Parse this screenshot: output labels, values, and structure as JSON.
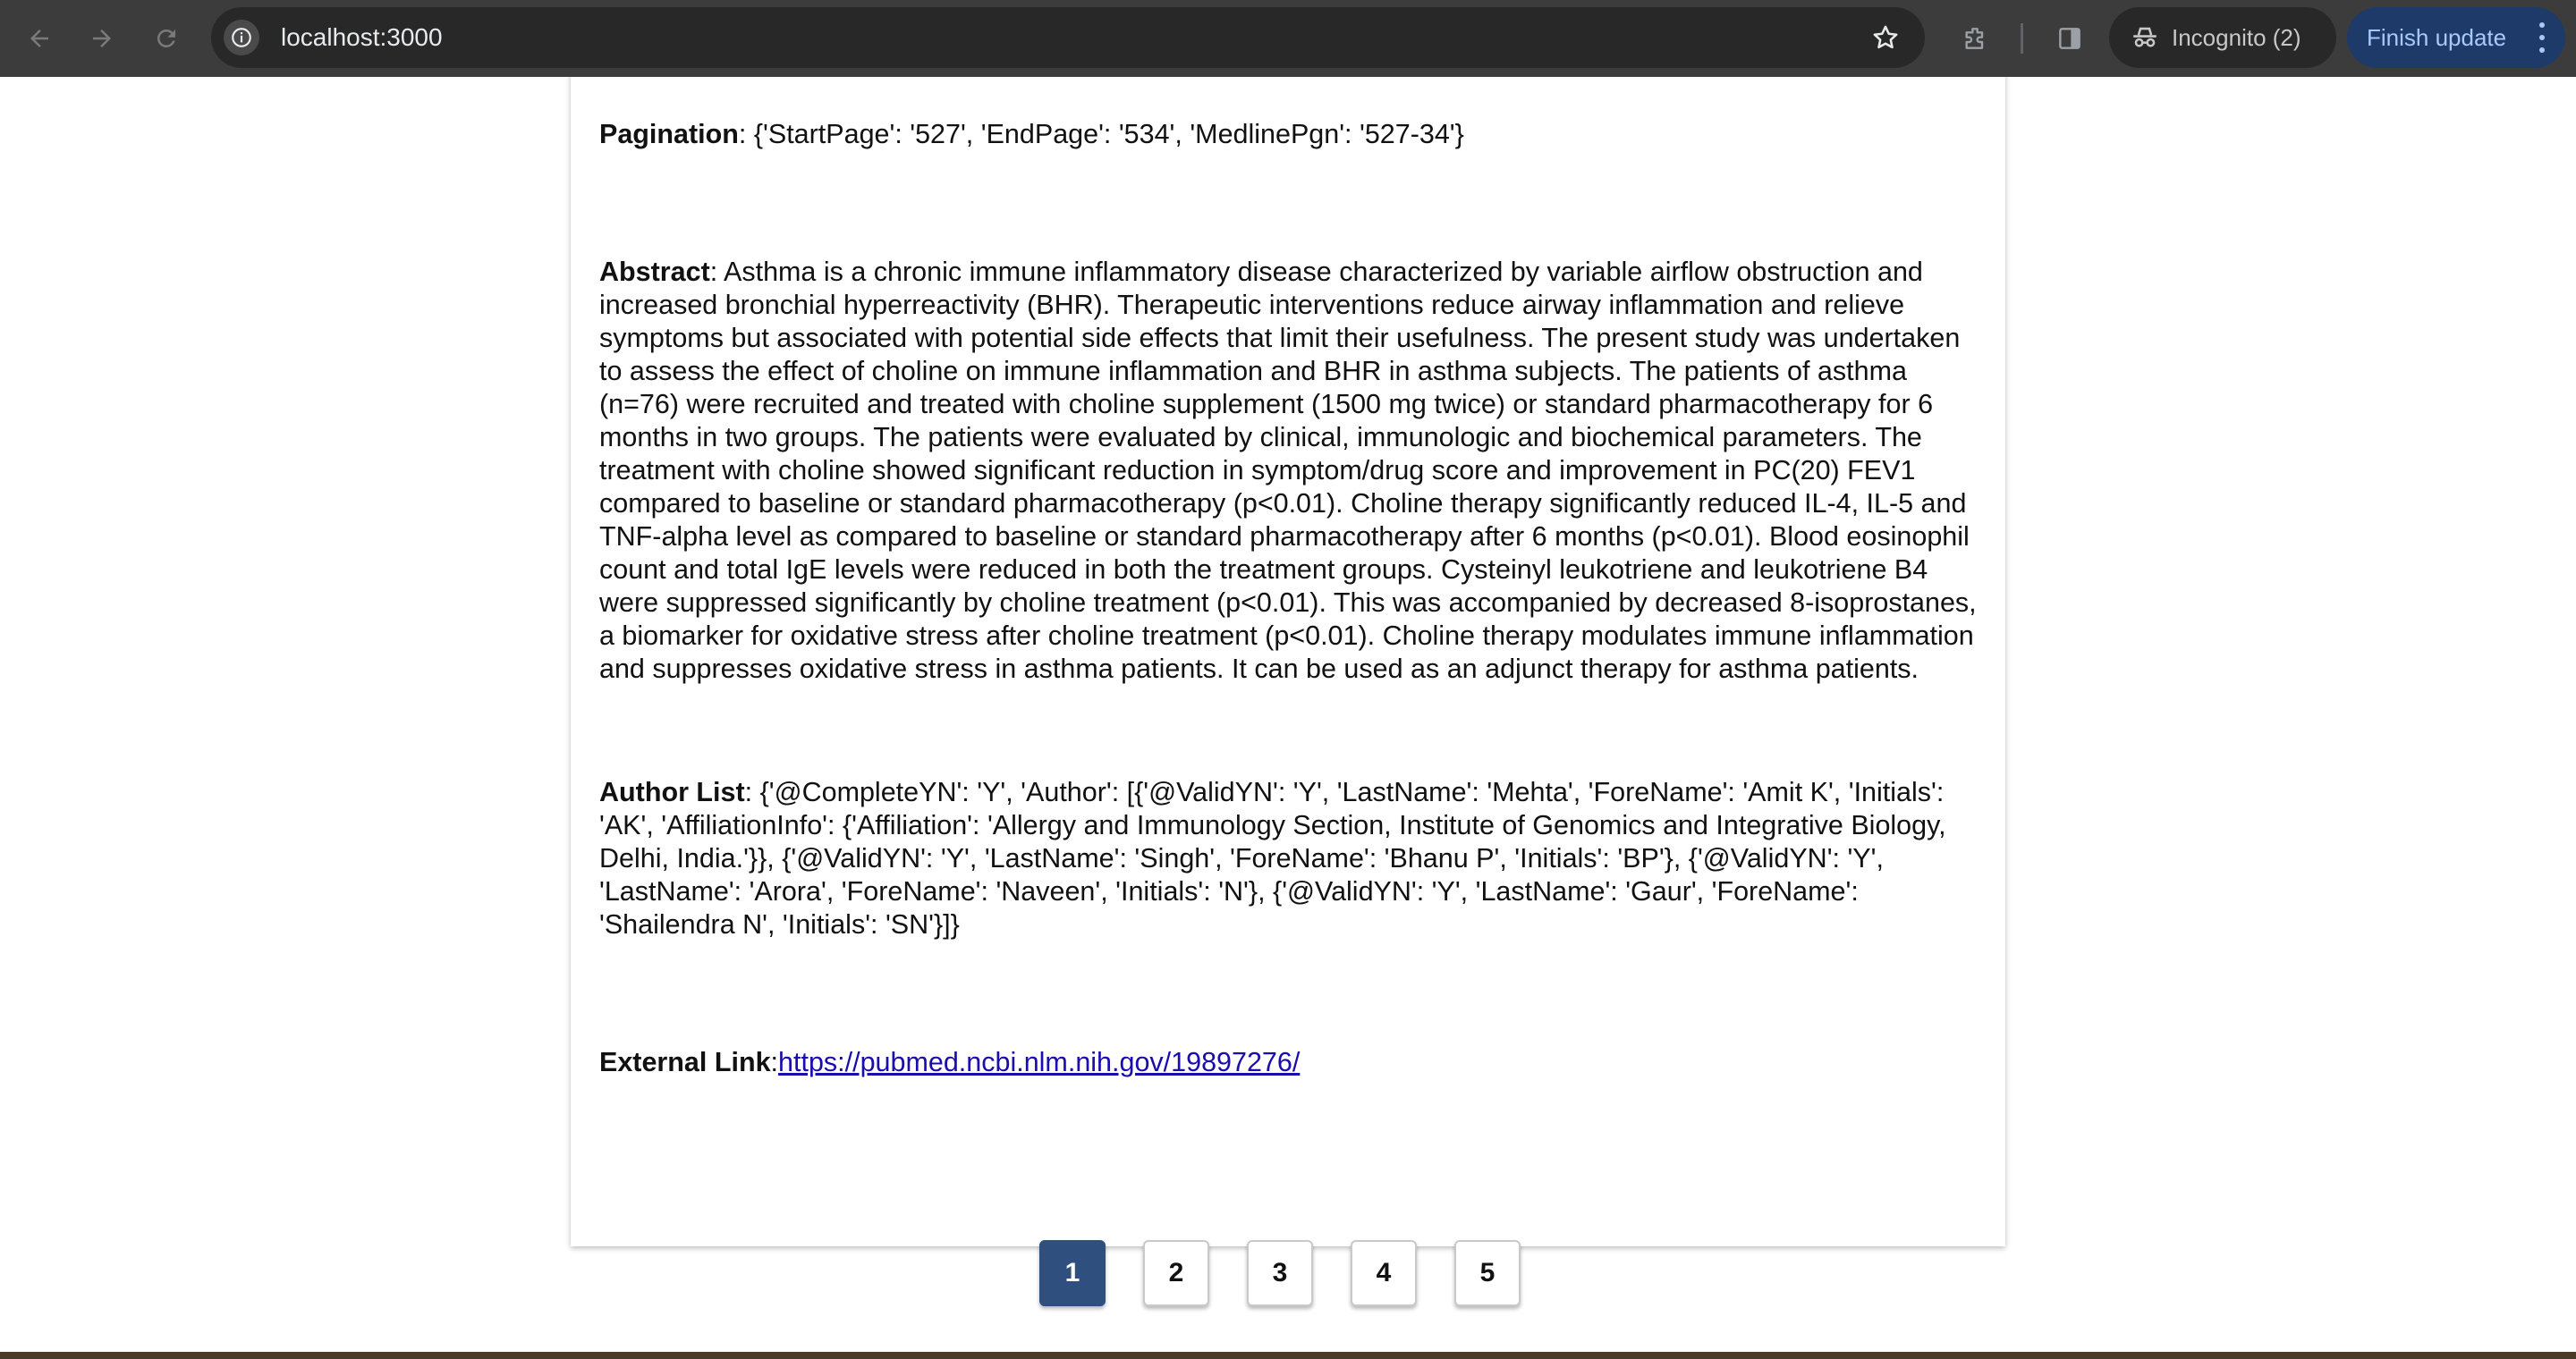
{
  "browser": {
    "url": "localhost:3000",
    "incognito_label": "Incognito (2)",
    "update_label": "Finish update"
  },
  "article": {
    "pagination": {
      "label": "Pagination",
      "value": ": {'StartPage': '527', 'EndPage': '534', 'MedlinePgn': '527-34'}"
    },
    "abstract": {
      "label": "Abstract",
      "value": ": Asthma is a chronic immune inflammatory disease characterized by variable airflow obstruction and increased bronchial hyperreactivity (BHR). Therapeutic interventions reduce airway inflammation and relieve symptoms but associated with potential side effects that limit their usefulness. The present study was undertaken to assess the effect of choline on immune inflammation and BHR in asthma subjects. The patients of asthma (n=76) were recruited and treated with choline supplement (1500 mg twice) or standard pharmacotherapy for 6 months in two groups. The patients were evaluated by clinical, immunologic and biochemical parameters. The treatment with choline showed significant reduction in symptom/drug score and improvement in PC(20) FEV1 compared to baseline or standard pharmacotherapy (p<0.01). Choline therapy significantly reduced IL-4, IL-5 and TNF-alpha level as compared to baseline or standard pharmacotherapy after 6 months (p<0.01). Blood eosinophil count and total IgE levels were reduced in both the treatment groups. Cysteinyl leukotriene and leukotriene B4 were suppressed significantly by choline treatment (p<0.01). This was accompanied by decreased 8-isoprostanes, a biomarker for oxidative stress after choline treatment (p<0.01). Choline therapy modulates immune inflammation and suppresses oxidative stress in asthma patients. It can be used as an adjunct therapy for asthma patients."
    },
    "authors": {
      "label": "Author List",
      "value": ": {'@CompleteYN': 'Y', 'Author': [{'@ValidYN': 'Y', 'LastName': 'Mehta', 'ForeName': 'Amit K', 'Initials': 'AK', 'AffiliationInfo': {'Affiliation': 'Allergy and Immunology Section, Institute of Genomics and Integrative Biology, Delhi, India.'}}, {'@ValidYN': 'Y', 'LastName': 'Singh', 'ForeName': 'Bhanu P', 'Initials': 'BP'}, {'@ValidYN': 'Y', 'LastName': 'Arora', 'ForeName': 'Naveen', 'Initials': 'N'}, {'@ValidYN': 'Y', 'LastName': 'Gaur', 'ForeName': 'Shailendra N', 'Initials': 'SN'}]}"
    },
    "external_link": {
      "label": "External Link",
      "separator": ":",
      "url": "https://pubmed.ncbi.nlm.nih.gov/19897276/"
    }
  },
  "pagination": {
    "pages": [
      "1",
      "2",
      "3",
      "4",
      "5"
    ],
    "current": "1"
  }
}
